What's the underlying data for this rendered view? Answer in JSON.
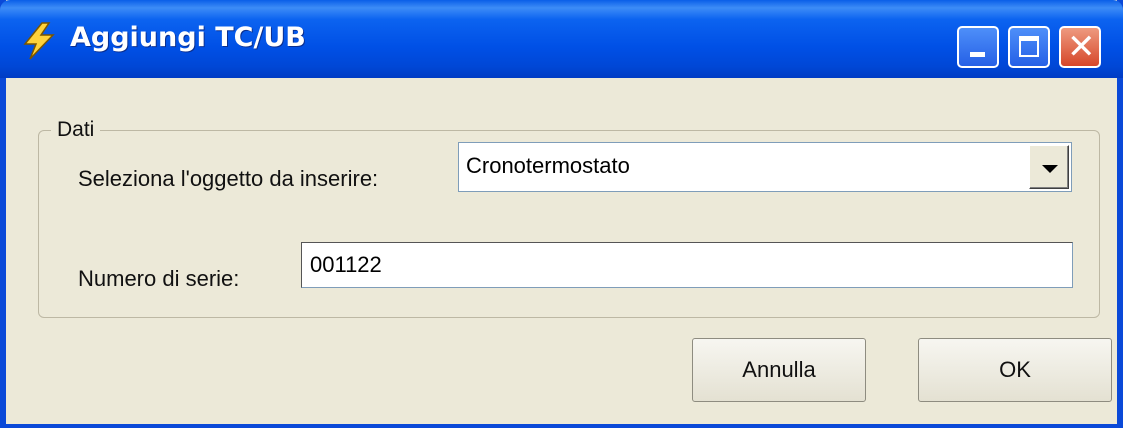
{
  "window": {
    "title": "Aggiungi TC/UB",
    "icon": "lightning-bolt-icon",
    "controls": {
      "minimize": "minimize-icon",
      "maximize": "maximize-icon",
      "close": "close-icon",
      "close_glyph": "✕"
    }
  },
  "group": {
    "legend": "Dati",
    "object_label": "Seleziona l'oggetto da inserire:",
    "object_value": "Cronotermostato",
    "serial_label": "Numero di serie:",
    "serial_value": "001122"
  },
  "buttons": {
    "cancel": "Annulla",
    "ok": "OK"
  },
  "colors": {
    "titlebar": "#0050e6",
    "face": "#ece9d8",
    "close": "#d6472a"
  }
}
